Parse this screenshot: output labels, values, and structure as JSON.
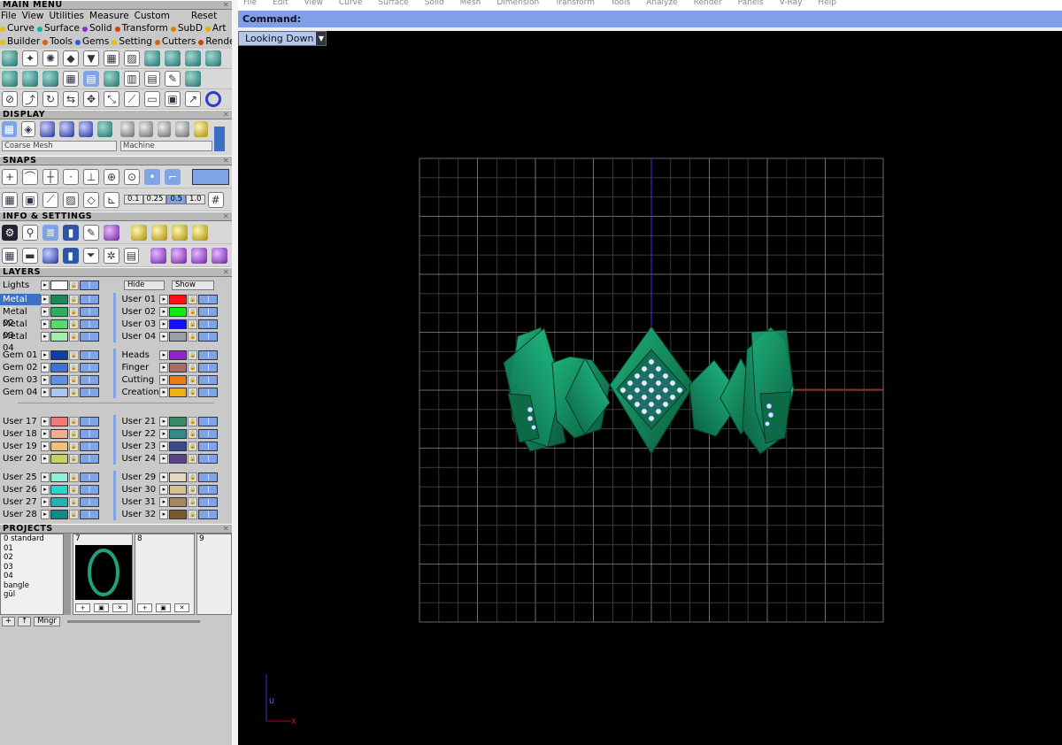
{
  "left": {
    "main_menu": {
      "title": "MAIN MENU",
      "items": [
        "File",
        "View",
        "Utilities",
        "Measure",
        "Custom"
      ],
      "reset": "Reset",
      "tabs_row1": [
        {
          "label": "Curve",
          "color": "#e8c000"
        },
        {
          "label": "Surface",
          "color": "#00b9a0"
        },
        {
          "label": "Solid",
          "color": "#8a2be2"
        },
        {
          "label": "Transform",
          "color": "#d44000"
        },
        {
          "label": "SubD",
          "color": "#e08000"
        },
        {
          "label": "Art",
          "color": "#e0b000"
        }
      ],
      "tabs_row2": [
        {
          "label": "Builder",
          "color": "#e8c000"
        },
        {
          "label": "Tools",
          "color": "#e06000"
        },
        {
          "label": "Gems",
          "color": "#2060e0"
        },
        {
          "label": "Setting",
          "color": "#e8c000"
        },
        {
          "label": "Cutters",
          "color": "#e06000"
        },
        {
          "label": "Render",
          "color": "#d04000"
        }
      ]
    },
    "display": {
      "title": "DISPLAY",
      "mesh_select": "Coarse Mesh",
      "material_select": "Machine"
    },
    "snaps": {
      "title": "SNAPS",
      "values": [
        "0.1",
        "0.25",
        "0.5",
        "1.0"
      ]
    },
    "info": {
      "title": "INFO & SETTINGS"
    },
    "layers": {
      "title": "LAYERS",
      "lights": "Lights",
      "hide": "Hide",
      "show": "Show",
      "group1_left": [
        {
          "name": "Metal 01",
          "color": "#1a8a55",
          "selected": true
        },
        {
          "name": "Metal 02",
          "color": "#2fae5e"
        },
        {
          "name": "Metal 03",
          "color": "#5fd86a"
        },
        {
          "name": "Metal 04",
          "color": "#a6ecb0"
        }
      ],
      "group1_right": [
        {
          "name": "User 01",
          "color": "#ff1010"
        },
        {
          "name": "User 02",
          "color": "#10ee10"
        },
        {
          "name": "User 03",
          "color": "#1010ff"
        },
        {
          "name": "User 04",
          "color": "#9aa0a6"
        }
      ],
      "group2_left": [
        {
          "name": "Gem 01",
          "color": "#0e3eaa"
        },
        {
          "name": "Gem 02",
          "color": "#3f72d6"
        },
        {
          "name": "Gem 03",
          "color": "#5c93e8"
        },
        {
          "name": "Gem 04",
          "color": "#a9c6f2"
        }
      ],
      "group2_right": [
        {
          "name": "Heads",
          "color": "#9a1fd0"
        },
        {
          "name": "Finger",
          "color": "#b06a6a"
        },
        {
          "name": "Cutting",
          "color": "#f07a10"
        },
        {
          "name": "Creation",
          "color": "#f0b010"
        }
      ],
      "group3_left": [
        {
          "name": "User 17",
          "color": "#f07a7a"
        },
        {
          "name": "User 18",
          "color": "#f0b090"
        },
        {
          "name": "User 19",
          "color": "#f0c080"
        },
        {
          "name": "User 20",
          "color": "#c8d068"
        }
      ],
      "group3_right": [
        {
          "name": "User 21",
          "color": "#3a8a6a"
        },
        {
          "name": "User 22",
          "color": "#2f8a88"
        },
        {
          "name": "User 23",
          "color": "#3a4a88"
        },
        {
          "name": "User 24",
          "color": "#5a4488"
        }
      ],
      "group4_left": [
        {
          "name": "User 25",
          "color": "#8ef0d8"
        },
        {
          "name": "User 26",
          "color": "#26d8c8"
        },
        {
          "name": "User 27",
          "color": "#20b4b0"
        },
        {
          "name": "User 28",
          "color": "#108a86"
        }
      ],
      "group4_right": [
        {
          "name": "User 29",
          "color": "#e6d8c0"
        },
        {
          "name": "User 30",
          "color": "#d8c090"
        },
        {
          "name": "User 31",
          "color": "#a88858"
        },
        {
          "name": "User 32",
          "color": "#7a5828"
        }
      ]
    },
    "projects": {
      "title": "PROJECTS",
      "list": [
        "0 standard",
        "01",
        "02",
        "03",
        "04",
        "bangle",
        "gül"
      ],
      "slots": [
        "7",
        "8",
        "9"
      ],
      "mngr": "Mngr"
    }
  },
  "viewport": {
    "menu_strip": [
      "File",
      "Edit",
      "View",
      "Curve",
      "Surface",
      "Solid",
      "Mesh",
      "Dimension",
      "Transform",
      "Tools",
      "Analyze",
      "Render",
      "Panels",
      "V-Ray",
      "Help"
    ],
    "command_label": "Command:",
    "view_name": "Looking Down",
    "axis_u": "U",
    "axis_x": "X"
  }
}
